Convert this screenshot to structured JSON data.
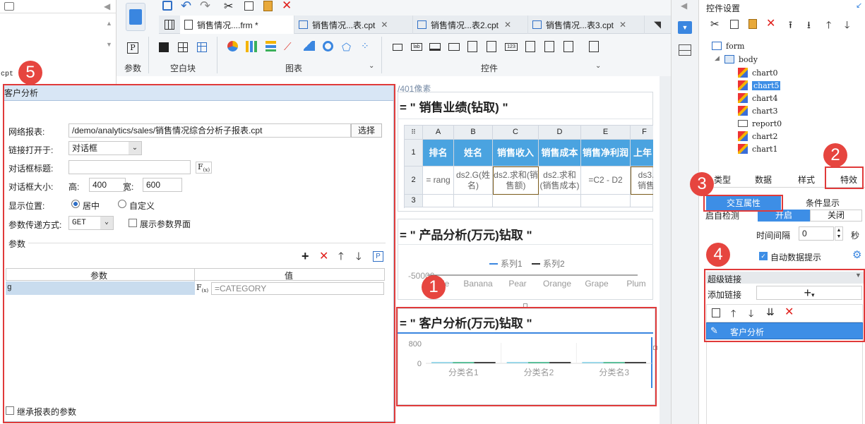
{
  "left_pane": {
    "cpt_label": "cpt"
  },
  "tabs": [
    {
      "label": "销售情况....frm *"
    },
    {
      "label": "销售情况...表.cpt"
    },
    {
      "label": "销售情况...表2.cpt"
    },
    {
      "label": "销售情况...表3.cpt"
    }
  ],
  "ribbon": {
    "param_label": "参数",
    "blank_label": "空白块",
    "chart_label": "图表",
    "widget_label": "控件"
  },
  "dialog": {
    "title": "客户分析",
    "report_label": "网络报表:",
    "report_value": "/demo/analytics/sales/销售情况综合分析子报表.cpt",
    "select_btn": "选择",
    "open_in_label": "链接打开于:",
    "open_in_value": "对话框",
    "dialog_title_label": "对话框标题:",
    "dialog_size_label": "对话框大小:",
    "height_label": "高:",
    "height_value": "400",
    "width_label": "宽:",
    "width_value": "600",
    "position_label": "显示位置:",
    "pos_center": "居中",
    "pos_custom": "自定义",
    "param_method_label": "参数传递方式:",
    "param_method_value": "GET",
    "show_param_label": "展示参数界面",
    "params_section": "参数",
    "param_col": "参数",
    "value_col": "值",
    "param_row_name": "g",
    "param_row_value": "=CATEGORY",
    "inherit_label": "继承报表的参数"
  },
  "canvas": {
    "size_label": "/401像素",
    "widget1_title": "销售业绩(钻取)",
    "grid_cols": [
      "A",
      "B",
      "C",
      "D",
      "E",
      "F"
    ],
    "grid_rows": [
      "1",
      "2",
      "3"
    ],
    "headers": [
      "排名",
      "姓名",
      "销售收入",
      "销售成本",
      "销售净利润",
      "上年"
    ],
    "row2": [
      "= rang",
      "ds2.G(姓名)",
      "ds2.求和(销售额)",
      "ds2.求和(销售成本)",
      "=C2 - D2",
      "ds3.销售"
    ],
    "widget2_title": "产品分析(万元)钻取",
    "widget3_title": "客户分析(万元)钻取"
  },
  "chart_data": [
    {
      "type": "line",
      "title": "产品分析(万元)钻取",
      "categories": [
        "Apple",
        "Banana",
        "Pear",
        "Orange",
        "Grape",
        "Plum"
      ],
      "series": [
        {
          "name": "系列1",
          "values": []
        },
        {
          "name": "系列2",
          "values": []
        }
      ],
      "y_tick": "-50000",
      "legend": "top-center"
    },
    {
      "type": "bar",
      "title": "客户分析(万元)钻取",
      "categories": [
        "分类名1",
        "分类名2",
        "分类名3"
      ],
      "y_ticks": [
        "800",
        "0"
      ],
      "legend": "none"
    }
  ],
  "right_panel": {
    "title": "控件设置",
    "tree": [
      "form",
      "body",
      "chart0",
      "chart5",
      "chart4",
      "chart3",
      "report0",
      "chart2",
      "chart1"
    ],
    "tabs": [
      "类型",
      "数据",
      "样式",
      "特效"
    ],
    "subtabs": [
      "交互属性",
      "条件显示"
    ],
    "auto_label": "启自检测",
    "on_label": "开启",
    "off_label": "关闭",
    "interval_label": "时间间隔",
    "interval_value": "0",
    "seconds_label": "秒",
    "auto_hint_label": "自动数据提示",
    "hyperlink_title": "超级链接",
    "add_link_label": "添加链接",
    "link_item": "客户分析"
  },
  "badges": [
    "1",
    "2",
    "3",
    "4",
    "5"
  ],
  "colors": {
    "accent": "#3a86e0",
    "red_annotation": "#e03a3a",
    "selected_row": "#3d8ee6"
  }
}
